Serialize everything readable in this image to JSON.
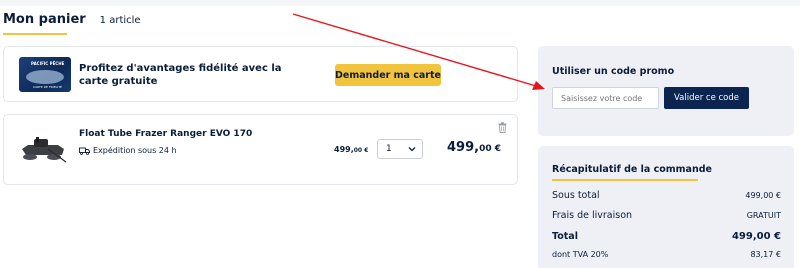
{
  "cart": {
    "title": "Mon panier",
    "count": "1 article"
  },
  "loyalty": {
    "card_brand": "PACIFIC PÊCHE",
    "card_subtitle": "CARTE DE FIDÉLITÉ",
    "text": "Profitez d'avantages fidélité avec la carte gratuite",
    "button": "Demander ma carte"
  },
  "product": {
    "name": "Float Tube Frazer Ranger EVO 170",
    "shipping": "Expédition sous 24 h",
    "unit_price_main": "499,",
    "unit_price_cents": "00 €",
    "quantity": "1",
    "total_main": "499,",
    "total_cents": "00 €"
  },
  "promo": {
    "title": "Utiliser un code promo",
    "placeholder": "Saisissez votre code",
    "button": "Valider ce code"
  },
  "summary": {
    "title": "Récapitulatif de la commande",
    "rows": [
      {
        "label": "Sous total",
        "value": "499,00 €"
      },
      {
        "label": "Frais de livraison",
        "value": "GRATUIT"
      },
      {
        "label": "Total",
        "value": "499,00 €"
      },
      {
        "label": "dont TVA 20%",
        "value": "83,17 €"
      }
    ]
  },
  "colors": {
    "navy": "#0b1d3a",
    "button_navy": "#0b2550",
    "yellow": "#f2c33c",
    "panel_bg": "#eef0f5",
    "annotation_red": "#e8141c"
  },
  "icons": [
    "truck-icon",
    "chevron-down-icon",
    "trash-icon",
    "annotation-arrow"
  ]
}
